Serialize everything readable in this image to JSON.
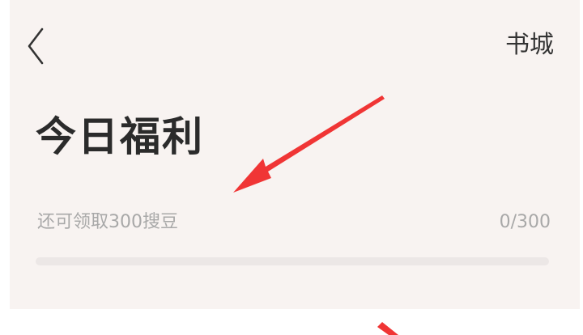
{
  "nav": {
    "back_icon": "chevron-left-icon",
    "store_label": "书城"
  },
  "welfare": {
    "title": "今日福利",
    "progress_label": "还可领取300搜豆",
    "progress_count": "0/300",
    "progress_fraction": 0
  },
  "colors": {
    "panel_background": "#f8f3f1",
    "annotation_arrow": "#f03535",
    "progress_track": "#ece7e6",
    "text_primary": "#2b2b2b",
    "text_secondary": "#a8a8a8"
  }
}
